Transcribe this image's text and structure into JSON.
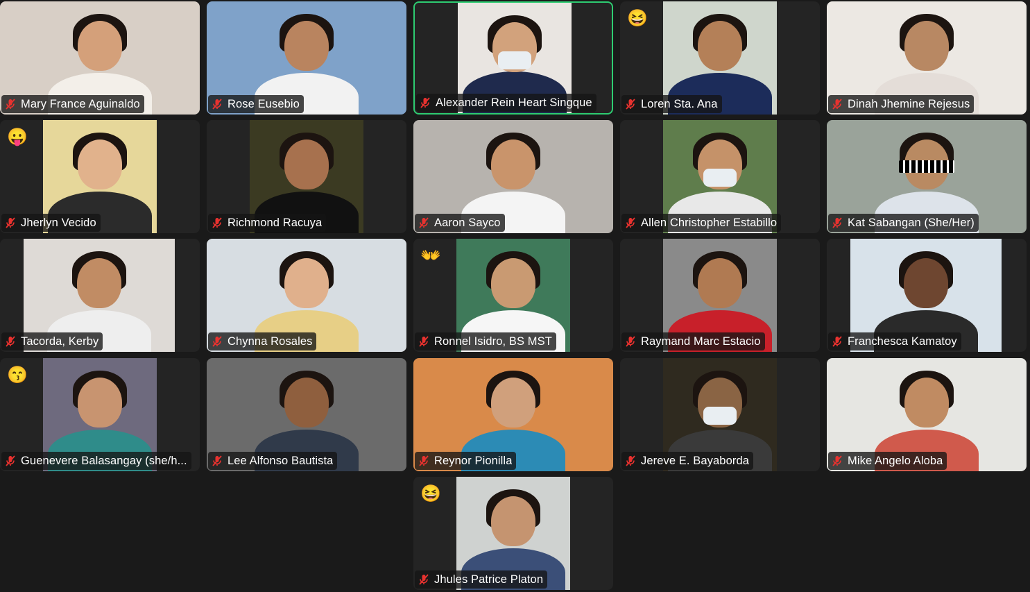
{
  "participants": [
    {
      "name": "Mary France Aguinaldo",
      "reaction": "",
      "active": false,
      "bg": "#d8cfc6",
      "skin": "#d4a07a",
      "shirt": "#f3efe9"
    },
    {
      "name": "Rose Eusebio",
      "reaction": "",
      "active": false,
      "bg": "#7fa2c9",
      "skin": "#b9845f",
      "shirt": "#f2f2f2"
    },
    {
      "name": "Alexander Rein Heart Singque",
      "reaction": "",
      "active": true,
      "bg": "#e9e5e1",
      "skin": "#d2a27c",
      "shirt": "#1f2a4d"
    },
    {
      "name": "Loren Sta. Ana",
      "reaction": "😆",
      "active": false,
      "bg": "#cfd6cc",
      "skin": "#b48058",
      "shirt": "#1c2c5a"
    },
    {
      "name": "Dinah Jhemine Rejesus",
      "reaction": "",
      "active": false,
      "bg": "#ece8e3",
      "skin": "#b88863",
      "shirt": "#e4ddd8"
    },
    {
      "name": "Jherlyn Vecido",
      "reaction": "😛",
      "active": false,
      "bg": "#e6d79a",
      "skin": "#e1b28c",
      "shirt": "#2b2b2b"
    },
    {
      "name": "Richmond Racuya",
      "reaction": "",
      "active": false,
      "bg": "#3b3a22",
      "skin": "#a7714e",
      "shirt": "#111111"
    },
    {
      "name": "Aaron Sayco",
      "reaction": "",
      "active": false,
      "bg": "#b7b3ae",
      "skin": "#c9946b",
      "shirt": "#f4f4f4"
    },
    {
      "name": "Allen Christopher Estabillo",
      "reaction": "",
      "active": false,
      "bg": "#5f7d4c",
      "skin": "#c59269",
      "shirt": "#e8e8e8"
    },
    {
      "name": "Kat Sabangan (She/Her)",
      "reaction": "",
      "active": false,
      "bg": "#9aa39a",
      "skin": "#b98a62",
      "shirt": "#dde3ea"
    },
    {
      "name": "Tacorda, Kerby",
      "reaction": "",
      "active": false,
      "bg": "#dedad6",
      "skin": "#c18c64",
      "shirt": "#eeeeee"
    },
    {
      "name": "Chynna Rosales",
      "reaction": "",
      "active": false,
      "bg": "#d7dde2",
      "skin": "#e0b08c",
      "shirt": "#e7cf86"
    },
    {
      "name": "Ronnel Isidro, BS MST",
      "reaction": "👐",
      "active": false,
      "bg": "#3f7a5a",
      "skin": "#c99a72",
      "shirt": "#f6f6f6"
    },
    {
      "name": "Raymand Marc Estacio",
      "reaction": "",
      "active": false,
      "bg": "#8a8a8a",
      "skin": "#b07a52",
      "shirt": "#c8202a"
    },
    {
      "name": "Franchesca Kamatoy",
      "reaction": "",
      "active": false,
      "bg": "#d8e2ea",
      "skin": "#6e4630",
      "shirt": "#2a2a2a"
    },
    {
      "name": "Guenevere Balasangay (she/h...",
      "reaction": "😙",
      "active": false,
      "bg": "#6e6a7e",
      "skin": "#c89470",
      "shirt": "#2f8c8a"
    },
    {
      "name": "Lee Alfonso Bautista",
      "reaction": "",
      "active": false,
      "bg": "#6b6b6b",
      "skin": "#8f5f3e",
      "shirt": "#303a4a"
    },
    {
      "name": "Reynor Pionilla",
      "reaction": "",
      "active": false,
      "bg": "#d98a4a",
      "skin": "#d0a07c",
      "shirt": "#2c8bb5"
    },
    {
      "name": "Jereve E. Bayaborda",
      "reaction": "",
      "active": false,
      "bg": "#2f2a1f",
      "skin": "#8a6444",
      "shirt": "#3a3a3a"
    },
    {
      "name": "Mike Angelo Aloba",
      "reaction": "",
      "active": false,
      "bg": "#e6e6e2",
      "skin": "#c08b62",
      "shirt": "#d05a4c"
    },
    {
      "name": "Jhules Patrice Platon",
      "reaction": "😆",
      "active": false,
      "bg": "#cfd2d0",
      "skin": "#c59470",
      "shirt": "#3b4f78"
    }
  ],
  "colors": {
    "background": "#1a1a1a",
    "tile": "#242424",
    "active_border": "#2ecc71",
    "muted_mic": "#e8322f"
  },
  "icons": {
    "muted": "mic-off-icon"
  }
}
